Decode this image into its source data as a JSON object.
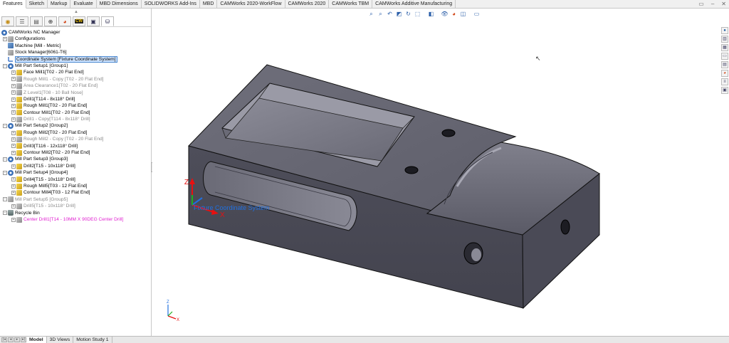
{
  "command_tabs": [
    {
      "label": "Features",
      "active": true
    },
    {
      "label": "Sketch"
    },
    {
      "label": "Markup"
    },
    {
      "label": "Evaluate"
    },
    {
      "label": "MBD Dimensions"
    },
    {
      "label": "SOLIDWORKS Add-Ins"
    },
    {
      "label": "MBD"
    },
    {
      "label": "CAMWorks 2020-WorkFlow"
    },
    {
      "label": "CAMWorks 2020"
    },
    {
      "label": "CAMWorks TBM"
    },
    {
      "label": "CAMWorks Additive Manufacturing"
    }
  ],
  "tree": {
    "root": "CAMWorks NC Manager",
    "items": [
      {
        "label": "Configurations"
      },
      {
        "label": "Machine [Mill - Metric]"
      },
      {
        "label": "Stock Manager[6061-T6]"
      },
      {
        "label": "Coordinate System [Fixture Coordinate System]"
      },
      {
        "label": "Mill Part Setup1 [Group1]"
      },
      {
        "label": "Face Mill1[T02 - 20 Flat End]"
      },
      {
        "label": "Rough Mill1 - Copy [T02 - 20 Flat End]"
      },
      {
        "label": "Area Clearance1[T02 - 20 Flat End]"
      },
      {
        "label": "Z Level1[T08 - 10 Ball Nose]"
      },
      {
        "label": "Drill1[T114 - 8x118° Drill]"
      },
      {
        "label": "Rough Mill1[T02 - 20 Flat End]"
      },
      {
        "label": "Contour Mill1[T02 - 20 Flat End]"
      },
      {
        "label": "Drill1 - Copy[T114 - 8x118° Drill]"
      },
      {
        "label": "Mill Part Setup2 [Group2]"
      },
      {
        "label": "Rough Mill2[T02 - 20 Flat End]"
      },
      {
        "label": "Rough Mill2 - Copy [T02 - 20 Flat End]"
      },
      {
        "label": "Drill3[T116 - 12x118° Drill]"
      },
      {
        "label": "Contour Mill2[T02 - 20 Flat End]"
      },
      {
        "label": "Mill Part Setup3 [Group3]"
      },
      {
        "label": "Drill2[T15 - 10x118° Drill]"
      },
      {
        "label": "Mill Part Setup4 [Group4]"
      },
      {
        "label": "Drill4[T15 - 10x118° Drill]"
      },
      {
        "label": "Rough Mill5[T03 - 12 Flat End]"
      },
      {
        "label": "Contour Mill4[T03 - 12 Flat End]"
      },
      {
        "label": "Mill Part Setup5 [Group5]"
      },
      {
        "label": "Drill5[T15 - 10x118° Drill]"
      },
      {
        "label": "Recycle Bin"
      },
      {
        "label": "Center Drill1[T14 - 10MM X 90DEG Center Drill]"
      }
    ]
  },
  "viewport": {
    "coordinate_system_label": "Fixture Coordinate System",
    "axis_x": "X",
    "axis_z": "Z",
    "triad_x": "X",
    "triad_z": "Z"
  },
  "bottom_tabs": [
    {
      "label": "Model",
      "active": true
    },
    {
      "label": "3D Views"
    },
    {
      "label": "Motion Study 1"
    }
  ],
  "colors": {
    "selection": "#cfe4ff",
    "selection_border": "#4a88d0",
    "disabled_text": "#8a8a8a",
    "unassigned_text": "#e020d0",
    "part_body": "#5a5a66"
  }
}
